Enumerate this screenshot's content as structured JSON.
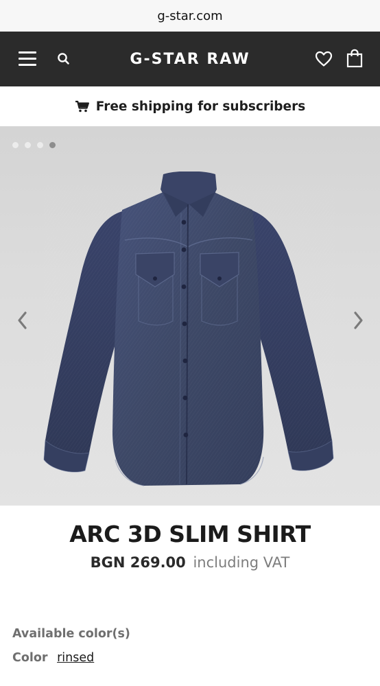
{
  "browser": {
    "url": "g-star.com"
  },
  "header": {
    "logo": "G-STAR RAW"
  },
  "promo": {
    "text": "Free shipping for subscribers"
  },
  "gallery": {
    "dot_count": 4,
    "active_index": 3
  },
  "product": {
    "title": "ARC 3D SLIM SHIRT",
    "price": "BGN 269.00",
    "vat_note": "including VAT"
  },
  "colors": {
    "heading": "Available color(s)",
    "label": "Color",
    "selected": "rinsed"
  },
  "icons": {
    "menu": "hamburger-menu-icon",
    "search": "search-icon",
    "wishlist": "heart-icon",
    "cart": "shopping-bag-icon",
    "promo": "cart-icon",
    "prev": "chevron-left-icon",
    "next": "chevron-right-icon"
  },
  "theme": {
    "header_bg": "#2b2b2b",
    "denim": "#3d4866"
  }
}
